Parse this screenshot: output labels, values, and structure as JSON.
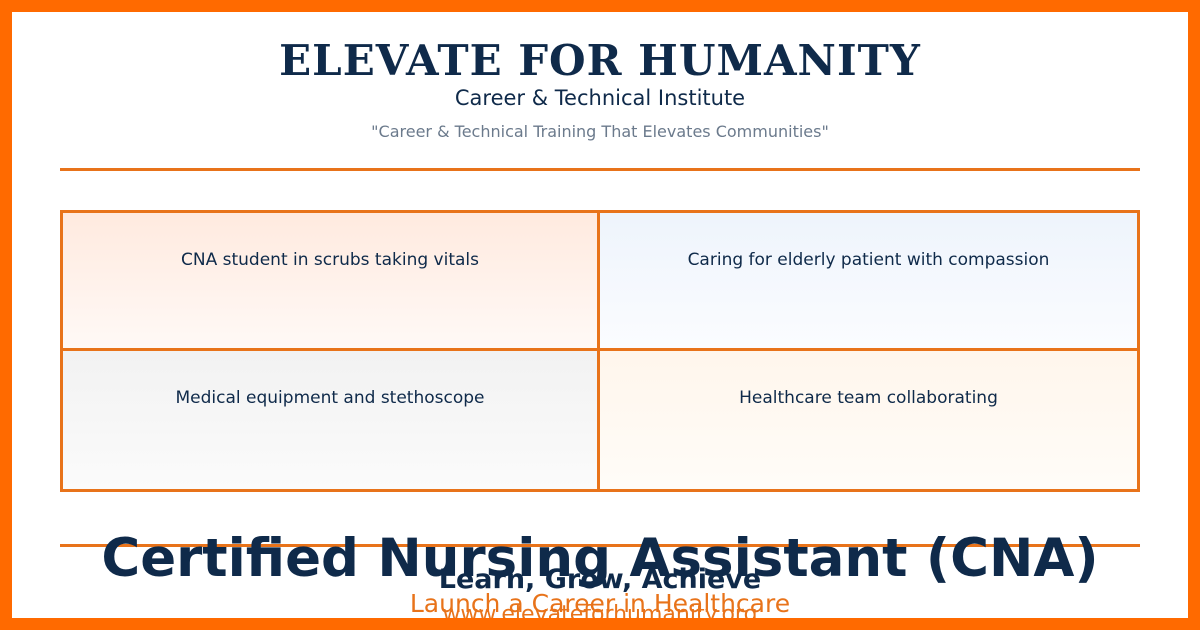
{
  "header": {
    "brand": "ELEVATE FOR HUMANITY",
    "subtitle": "Career & Technical Institute",
    "tagline": "\"Career & Technical Training That Elevates Communities\""
  },
  "images": [
    {
      "caption": "CNA student in scrubs taking vitals"
    },
    {
      "caption": "Caring for elderly patient with compassion"
    },
    {
      "caption": "Medical equipment and stethoscope"
    },
    {
      "caption": "Healthcare team collaborating"
    }
  ],
  "footer": {
    "headline": "Certified Nursing Assistant (CNA)",
    "motto": "Learn, Grow, Achieve",
    "cta": "Launch a Career in Healthcare",
    "url": "www.elevateforhumanity.org"
  },
  "colors": {
    "border": "#ff6a00",
    "accent": "#e8731a",
    "navy": "#0f2a4a",
    "muted": "#6b7a8c"
  }
}
